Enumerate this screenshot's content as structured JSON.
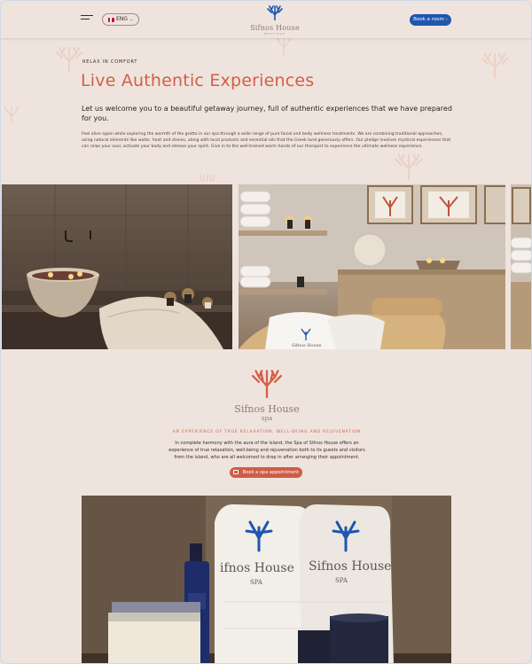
{
  "header": {
    "lang_label": "ENG",
    "logo_text": "Sifnos House",
    "logo_sub": "BOUTIQUE",
    "book_room_label": "Book a room",
    "book_room_arrow": "›"
  },
  "intro": {
    "eyebrow": "RELAX IN COMFORT",
    "title": "Live Authentic Experiences",
    "lead": "Let us welcome you to a beautiful getaway journey, full of authentic experiences that we have prepared for you.",
    "body": "Feel alive again while exploring the warmth of the grotto in our spa through a wide range of pure facial and body wellness treatments. We are combining traditional approaches, using natural elements like water, heat and stones, along with local products and essential oils that the Greek land generously offers. Our pledge involves mystical experiences that can relax your soul, activate your body and release your spirit. Give in to the well-trained warm hands of our therapist to experience the ultimate wellness experience."
  },
  "spa": {
    "logo_text": "Sifnos House",
    "logo_sub": "spa",
    "tagline": "AN EXPERIENCE OF TRUE RELAXATION, WELL-BEING AND REJUVENATION",
    "text": "In complete harmony with the aura of the island, the Spa of Sifnos House offers an experience of true relaxation, well-being and rejuvenation both to its guests and visitors from the island, who are all welcomed to drop in after arranging their appointment.",
    "button_label": "Book a spa appointment",
    "towel_text": "Sifnos House",
    "towel_sub": "SPA",
    "towel_text_2": "ifnos House",
    "towel_text_3": "Sifnos House"
  },
  "colors": {
    "accent": "#d25f47",
    "brand_blue": "#1e56b0",
    "background": "#efe4dd"
  },
  "icons": {
    "menu": "hamburger-icon",
    "flag": "uk-flag-icon",
    "calendar": "calendar-icon",
    "coral": "coral-icon"
  }
}
